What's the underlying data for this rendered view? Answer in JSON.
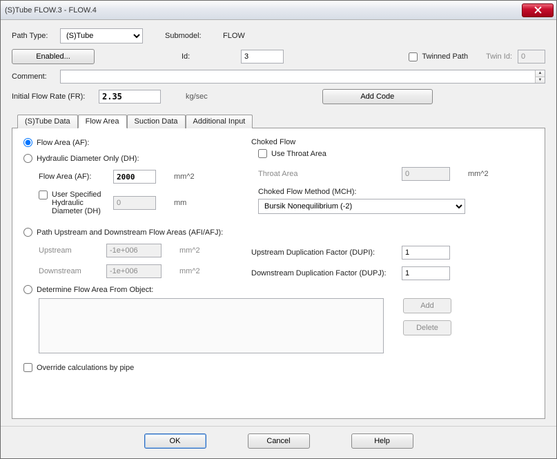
{
  "window": {
    "title": "(S)Tube FLOW.3 - FLOW.4"
  },
  "topform": {
    "path_type_label": "Path Type:",
    "path_type_value": "(S)Tube",
    "submodel_label": "Submodel:",
    "submodel_value": "FLOW",
    "enabled_btn": "Enabled...",
    "id_label": "Id:",
    "id_value": "3",
    "twinned_label": "Twinned Path",
    "twin_id_label": "Twin Id:",
    "twin_id_value": "0",
    "comment_label": "Comment:",
    "comment_value": "",
    "ifr_label": "Initial Flow Rate (FR):",
    "ifr_value": "2.35",
    "ifr_unit": "kg/sec",
    "add_code_btn": "Add Code"
  },
  "tabs": [
    {
      "label": "(S)Tube Data",
      "active": false
    },
    {
      "label": "Flow Area",
      "active": true
    },
    {
      "label": "Suction Data",
      "active": false
    },
    {
      "label": "Additional Input",
      "active": false
    }
  ],
  "flow_area_tab": {
    "opt_af": "Flow Area (AF):",
    "opt_dh": "Hydraulic Diameter Only (DH):",
    "flow_area_label": "Flow Area (AF):",
    "flow_area_value": "2000",
    "flow_area_unit": "mm^2",
    "user_spec_dh_chk": "User Specified Hydraulic Diameter (DH)",
    "user_spec_dh_value": "0",
    "user_spec_dh_unit": "mm",
    "opt_afiafj": "Path Upstream and Downstream Flow Areas (AFI/AFJ):",
    "upstream_label": "Upstream",
    "upstream_value": "-1e+006",
    "upstream_unit": "mm^2",
    "downstream_label": "Downstream",
    "downstream_value": "-1e+006",
    "downstream_unit": "mm^2",
    "opt_fromobj": "Determine Flow Area From Object:",
    "add_btn": "Add",
    "delete_btn": "Delete",
    "override_chk": "Override calculations by pipe",
    "choked_title": "Choked Flow",
    "use_throat_chk": "Use Throat Area",
    "throat_label": "Throat Area",
    "throat_value": "0",
    "throat_unit": "mm^2",
    "mch_label": "Choked Flow Method (MCH):",
    "mch_value": "Bursik Nonequilibrium (-2)",
    "dupi_label": "Upstream Duplication Factor (DUPI):",
    "dupi_value": "1",
    "dupj_label": "Downstream Duplication Factor (DUPJ):",
    "dupj_value": "1"
  },
  "footer": {
    "ok": "OK",
    "cancel": "Cancel",
    "help": "Help"
  }
}
